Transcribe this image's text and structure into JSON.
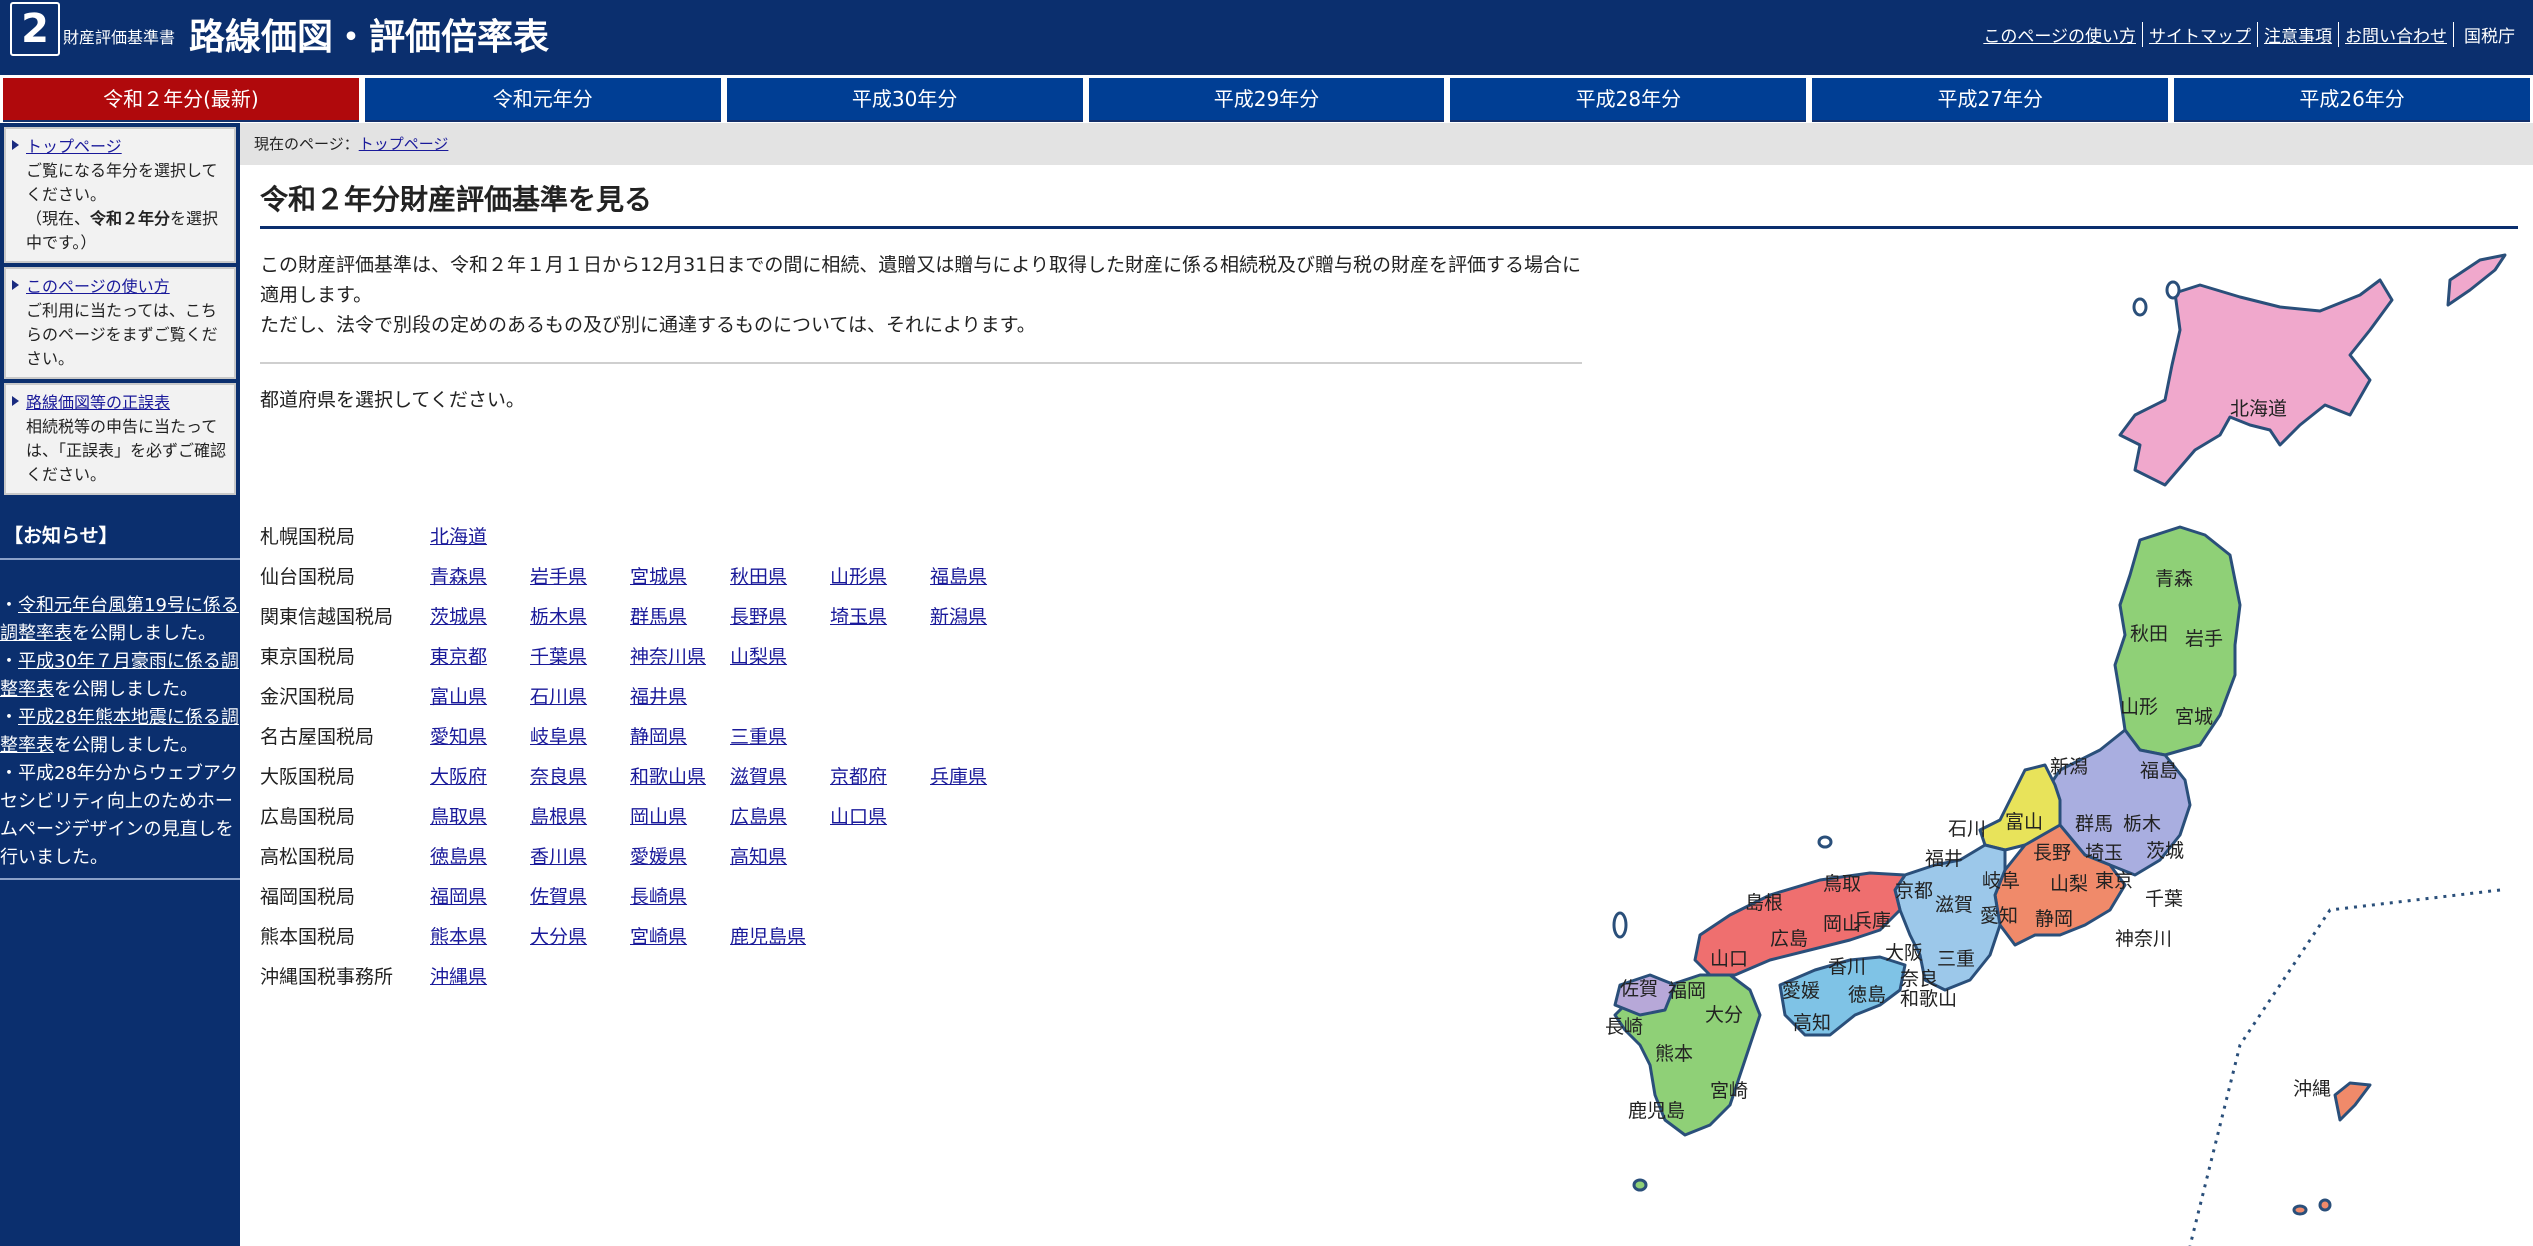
{
  "header": {
    "logo_number": "2",
    "site_small": "財産評価基準書",
    "title": "路線価図・評価倍率表",
    "links": [
      "このページの使い方",
      "サイトマップ",
      "注意事項",
      "お問い合わせ"
    ],
    "agency": "国税庁"
  },
  "tabs": [
    {
      "label": "令和２年分(最新)",
      "active": true
    },
    {
      "label": "令和元年分"
    },
    {
      "label": "平成30年分"
    },
    {
      "label": "平成29年分"
    },
    {
      "label": "平成28年分"
    },
    {
      "label": "平成27年分"
    },
    {
      "label": "平成26年分"
    }
  ],
  "sidebar": {
    "boxes": [
      {
        "link": "トップページ",
        "text1": "ご覧になる年分を選択してください。",
        "text2": "（現在、",
        "bold": "令和２年分",
        "text3": "を選択中です。）"
      },
      {
        "link": "このページの使い方",
        "text": "ご利用に当たっては、こちらのページをまずご覧ください。"
      },
      {
        "link": "路線価図等の正誤表",
        "text": "相続税等の申告に当たっては、「正誤表」を必ずご確認ください。"
      }
    ],
    "notice_title": "【お知らせ】",
    "notices": [
      {
        "prefix": "・",
        "link": "令和元年台風第19号に係る調整率表",
        "suffix": "を公開しました。"
      },
      {
        "prefix": "・",
        "link": "平成30年７月豪雨に係る調整率表",
        "suffix": "を公開しました。"
      },
      {
        "prefix": "・",
        "link": "平成28年熊本地震に係る調整率表",
        "suffix": "を公開しました。"
      },
      {
        "prefix": "・",
        "link": "",
        "suffix": "平成28年分からウェブアクセシビリティ向上のためホームページデザインの見直しを行いました。"
      }
    ]
  },
  "breadcrumb": {
    "prefix": "現在のページ：",
    "link": "トップページ"
  },
  "main": {
    "title": "令和２年分財産評価基準を見る",
    "intro1": "この財産評価基準は、令和２年１月１日から12月31日までの間に相続、遺贈又は贈与により取得した財産に係る相続税及び贈与税の財産を評価する場合に適用します。",
    "intro2": "ただし、法令で別段の定めのあるもの及び別に通達するものについては、それによります。",
    "select_prompt": "都道府県を選択してください。"
  },
  "bureaus": [
    {
      "name": "札幌国税局",
      "prefs": [
        "北海道"
      ]
    },
    {
      "name": "仙台国税局",
      "prefs": [
        "青森県",
        "岩手県",
        "宮城県",
        "秋田県",
        "山形県",
        "福島県"
      ]
    },
    {
      "name": "関東信越国税局",
      "prefs": [
        "茨城県",
        "栃木県",
        "群馬県",
        "長野県",
        "埼玉県",
        "新潟県"
      ]
    },
    {
      "name": "東京国税局",
      "prefs": [
        "東京都",
        "千葉県",
        "神奈川県",
        "山梨県"
      ]
    },
    {
      "name": "金沢国税局",
      "prefs": [
        "富山県",
        "石川県",
        "福井県"
      ]
    },
    {
      "name": "名古屋国税局",
      "prefs": [
        "愛知県",
        "岐阜県",
        "静岡県",
        "三重県"
      ]
    },
    {
      "name": "大阪国税局",
      "prefs": [
        "大阪府",
        "奈良県",
        "和歌山県",
        "滋賀県",
        "京都府",
        "兵庫県"
      ]
    },
    {
      "name": "広島国税局",
      "prefs": [
        "鳥取県",
        "島根県",
        "岡山県",
        "広島県",
        "山口県"
      ]
    },
    {
      "name": "高松国税局",
      "prefs": [
        "徳島県",
        "香川県",
        "愛媛県",
        "高知県"
      ]
    },
    {
      "name": "福岡国税局",
      "prefs": [
        "福岡県",
        "佐賀県",
        "長崎県"
      ]
    },
    {
      "name": "熊本国税局",
      "prefs": [
        "熊本県",
        "大分県",
        "宮崎県",
        "鹿児島県"
      ]
    },
    {
      "name": "沖縄国税事務所",
      "prefs": [
        "沖縄県"
      ]
    }
  ],
  "map_labels": {
    "hokkaido": "北海道",
    "aomori": "青森",
    "akita": "秋田",
    "iwate": "岩手",
    "yamagata": "山形",
    "miyagi": "宮城",
    "fukushima": "福島",
    "niigata": "新潟",
    "toyama": "富山",
    "ishikawa": "石川",
    "fukui": "福井",
    "gunma": "群馬",
    "tochigi": "栃木",
    "ibaraki": "茨城",
    "nagano": "長野",
    "saitama": "埼玉",
    "gifu": "岐阜",
    "yamanashi": "山梨",
    "tokyo": "東京",
    "chiba": "千葉",
    "kanagawa": "神奈川",
    "shizuoka": "静岡",
    "aichi": "愛知",
    "shiga": "滋賀",
    "kyoto": "京都",
    "hyogo": "兵庫",
    "osaka": "大阪",
    "nara": "奈良",
    "mie": "三重",
    "wakayama": "和歌山",
    "tottori": "鳥取",
    "shimane": "島根",
    "okayama": "岡山",
    "hiroshima": "広島",
    "yamaguchi": "山口",
    "kagawa": "香川",
    "tokushima": "徳島",
    "ehime": "愛媛",
    "kochi": "高知",
    "fukuoka": "福岡",
    "saga": "佐賀",
    "nagasaki": "長崎",
    "oita": "大分",
    "kumamoto": "熊本",
    "miyazaki": "宮崎",
    "kagoshima": "鹿児島",
    "okinawa": "沖縄"
  },
  "colors": {
    "header_bg": "#0b2f6e",
    "tab_bg": "#003e94",
    "tab_active": "#b0090c",
    "hokkaido": "#f0a8cc",
    "tohoku": "#8fd077",
    "kanto": "#a9aee0",
    "hokuriku": "#e8e35a",
    "tokai": "#f08a6a",
    "kinki": "#9cc8ea",
    "chugoku": "#ef6f6f",
    "shikoku": "#7fc3e6",
    "kyushu": "#8fd077",
    "okinawa": "#f08a6a"
  }
}
